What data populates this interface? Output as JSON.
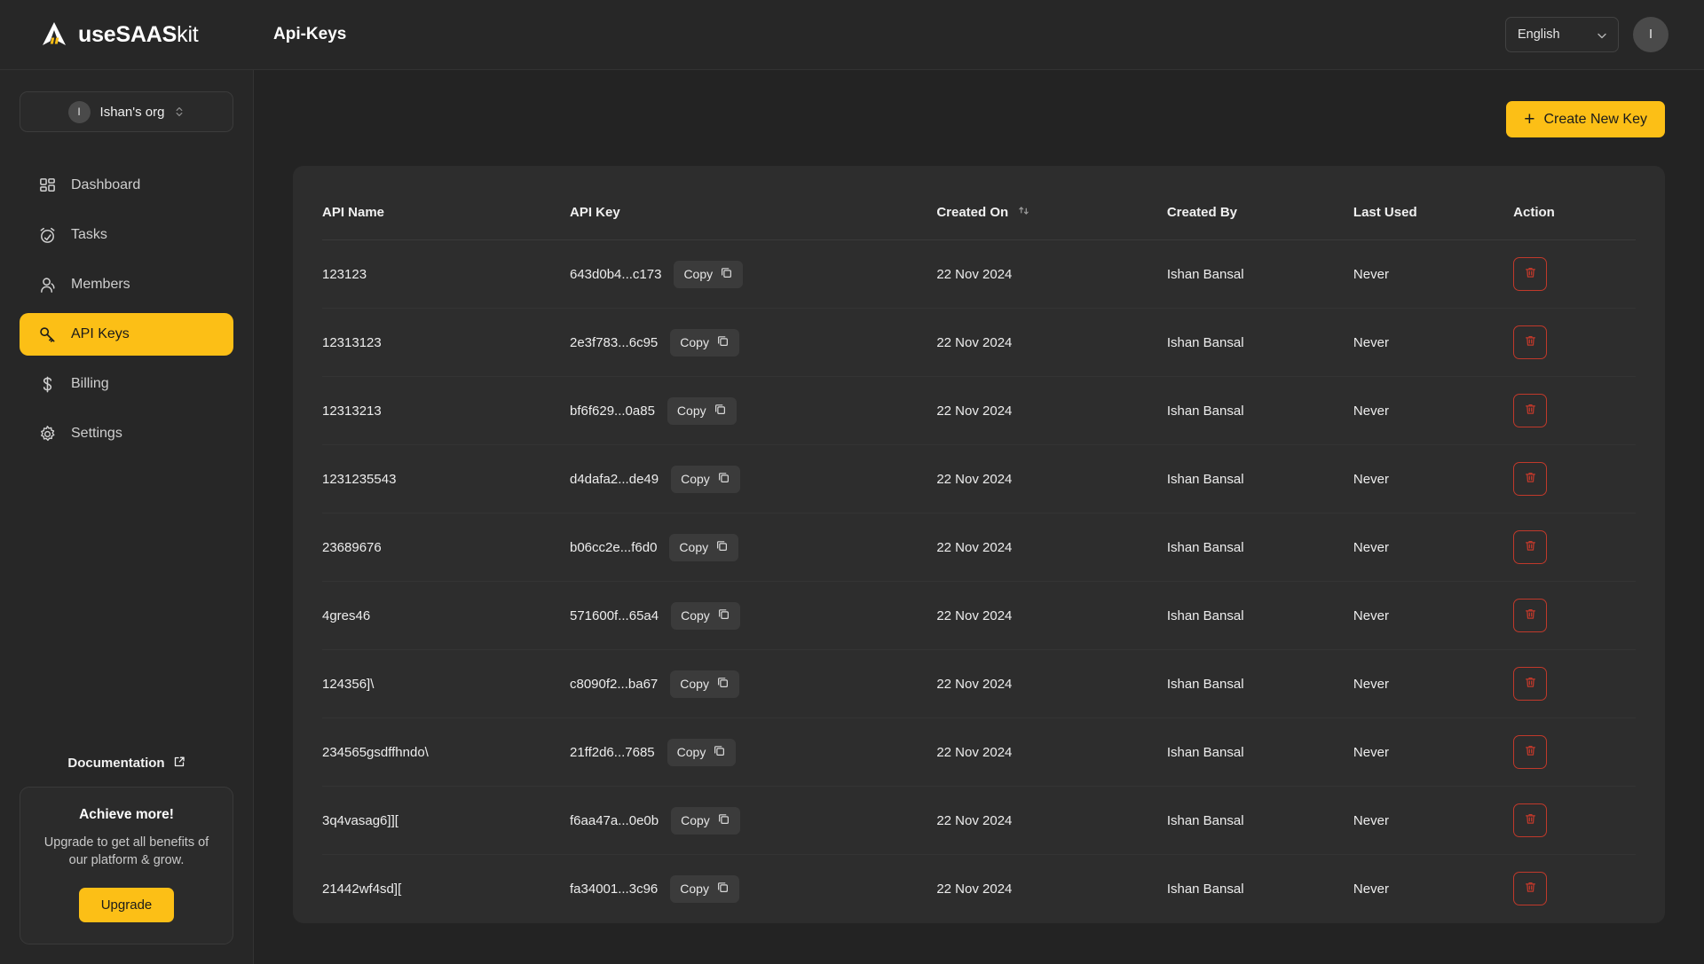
{
  "brand": {
    "bold": "useSAAS",
    "light": "kit",
    "logo_icon": "usesaaskit-logo-icon"
  },
  "topbar": {
    "page_title": "Api-Keys",
    "language": "English",
    "language_chevron_icon": "chevron-down-icon",
    "user_avatar_initial": "I"
  },
  "sidebar": {
    "org": {
      "avatar_initial": "I",
      "name": "Ishan's org",
      "switch_icon": "chevron-up-down-icon"
    },
    "items": [
      {
        "label": "Dashboard",
        "icon": "grid-icon",
        "active": false
      },
      {
        "label": "Tasks",
        "icon": "alarm-clock-icon",
        "active": false
      },
      {
        "label": "Members",
        "icon": "user-icon",
        "active": false
      },
      {
        "label": "API Keys",
        "icon": "key-icon",
        "active": true
      },
      {
        "label": "Billing",
        "icon": "dollar-icon",
        "active": false
      },
      {
        "label": "Settings",
        "icon": "gear-icon",
        "active": false
      }
    ],
    "documentation": {
      "label": "Documentation",
      "icon": "external-link-icon"
    },
    "promo": {
      "title": "Achieve more!",
      "subtitle": "Upgrade to get all benefits of our platform & grow.",
      "button": "Upgrade"
    }
  },
  "main": {
    "create_button": {
      "label": "Create New Key",
      "icon": "plus-icon"
    },
    "table": {
      "columns": [
        "API Name",
        "API Key",
        "Created On",
        "Created By",
        "Last Used",
        "Action"
      ],
      "sort_column": "Created On",
      "sort_icon": "sort-updown-icon",
      "copy_label": "Copy",
      "copy_icon": "copy-icon",
      "delete_icon": "trash-icon",
      "rows": [
        {
          "name": "123123",
          "key": "643d0b4...c173",
          "created_on": "22 Nov 2024",
          "created_by": "Ishan Bansal",
          "last_used": "Never"
        },
        {
          "name": "12313123",
          "key": "2e3f783...6c95",
          "created_on": "22 Nov 2024",
          "created_by": "Ishan Bansal",
          "last_used": "Never"
        },
        {
          "name": "12313213",
          "key": "bf6f629...0a85",
          "created_on": "22 Nov 2024",
          "created_by": "Ishan Bansal",
          "last_used": "Never"
        },
        {
          "name": "1231235543",
          "key": "d4dafa2...de49",
          "created_on": "22 Nov 2024",
          "created_by": "Ishan Bansal",
          "last_used": "Never"
        },
        {
          "name": "23689676",
          "key": "b06cc2e...f6d0",
          "created_on": "22 Nov 2024",
          "created_by": "Ishan Bansal",
          "last_used": "Never"
        },
        {
          "name": "4gres46",
          "key": "571600f...65a4",
          "created_on": "22 Nov 2024",
          "created_by": "Ishan Bansal",
          "last_used": "Never"
        },
        {
          "name": "124356]\\",
          "key": "c8090f2...ba67",
          "created_on": "22 Nov 2024",
          "created_by": "Ishan Bansal",
          "last_used": "Never"
        },
        {
          "name": "234565gsdffhndo\\",
          "key": "21ff2d6...7685",
          "created_on": "22 Nov 2024",
          "created_by": "Ishan Bansal",
          "last_used": "Never"
        },
        {
          "name": "3q4vasag6]][",
          "key": "f6aa47a...0e0b",
          "created_on": "22 Nov 2024",
          "created_by": "Ishan Bansal",
          "last_used": "Never"
        },
        {
          "name": "21442wf4sd][",
          "key": "fa34001...3c96",
          "created_on": "22 Nov 2024",
          "created_by": "Ishan Bansal",
          "last_used": "Never"
        }
      ]
    }
  },
  "colors": {
    "accent": "#FCBF16",
    "page_bg": "#232323",
    "panel_bg": "#272727",
    "card_bg": "#2d2d2d",
    "danger": "#c0392b"
  }
}
